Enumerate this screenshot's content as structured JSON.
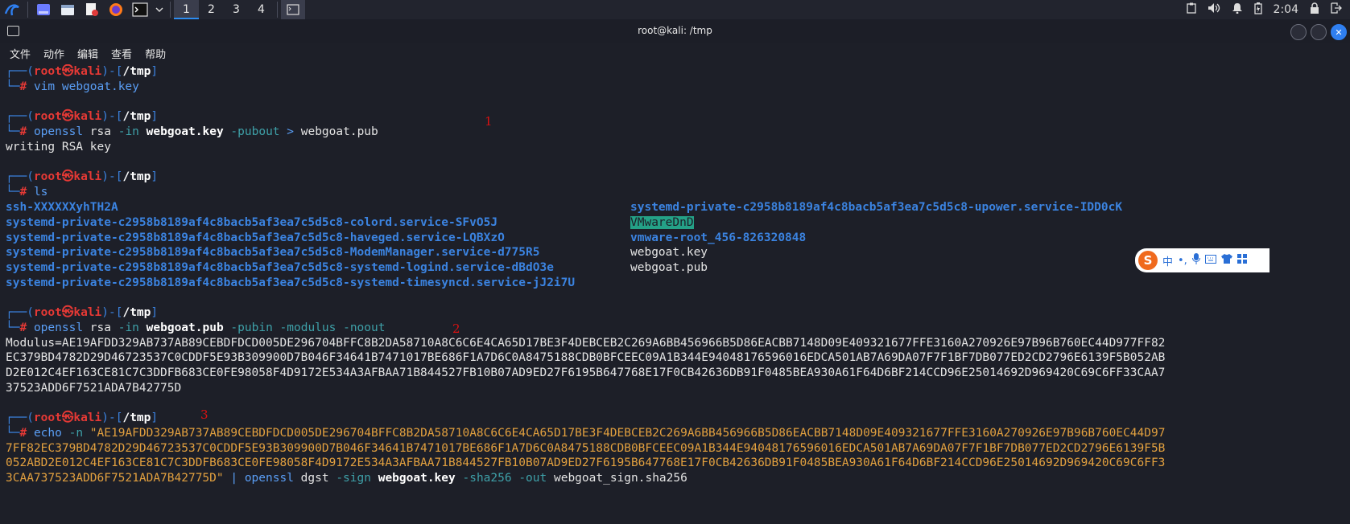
{
  "panel": {
    "workspaces": [
      "1",
      "2",
      "3",
      "4"
    ],
    "clock": "2:04"
  },
  "window": {
    "title": "root@kali: /tmp"
  },
  "menu": [
    "文件",
    "动作",
    "编辑",
    "查看",
    "帮助"
  ],
  "prompt": {
    "user": "root",
    "at": "㉿",
    "host": "kali",
    "dir": "/tmp"
  },
  "commands": {
    "c1": "vim webgoat.key",
    "c2_cmd": "openssl",
    "c2_a": "rsa",
    "c2_in": "-in",
    "c2_file": "webgoat.key",
    "c2_pubout": "-pubout",
    "c2_redir": ">",
    "c2_out": "webgoat.pub",
    "c2_output": "writing RSA key",
    "c3": "ls",
    "c4_cmd": "openssl",
    "c4_a": "rsa",
    "c4_in": "-in",
    "c4_file": "webgoat.pub",
    "c4_opts": "-pubin -modulus -noout",
    "c5_cmd": "echo",
    "c5_n": "-n",
    "c5_pipe": "|",
    "c5_tool": "openssl",
    "c5_sub": "dgst",
    "c5_sign": "-sign",
    "c5_key": "webgoat.key",
    "c5_sha": "-sha256",
    "c5_outflag": "-out",
    "c5_outfile": "webgoat_sign.sha256"
  },
  "ls_left": [
    "ssh-XXXXXXyhTH2A",
    "systemd-private-c2958b8189af4c8bacb5af3ea7c5d5c8-colord.service-SFvO5J",
    "systemd-private-c2958b8189af4c8bacb5af3ea7c5d5c8-haveged.service-LQBXzO",
    "systemd-private-c2958b8189af4c8bacb5af3ea7c5d5c8-ModemManager.service-d775R5",
    "systemd-private-c2958b8189af4c8bacb5af3ea7c5d5c8-systemd-logind.service-dBdO3e",
    "systemd-private-c2958b8189af4c8bacb5af3ea7c5d5c8-systemd-timesyncd.service-jJ2i7U"
  ],
  "ls_right": [
    "systemd-private-c2958b8189af4c8bacb5af3ea7c5d5c8-upower.service-IDD0cK",
    "VMwareDnD",
    "vmware-root_456-826320848",
    "webgoat.key",
    "webgoat.pub"
  ],
  "modulus_lines": [
    "Modulus=AE19AFDD329AB737AB89CEBDFDCD005DE296704BFFC8B2DA58710A8C6C6E4CA65D17BE3F4DEBCEB2C269A6BB456966B5D86EACBB7148D09E409321677FFE3160A270926E97B96B760EC44D977FF82",
    "EC379BD4782D29D46723537C0CDDF5E93B309900D7B046F34641B7471017BE686F1A7D6C0A8475188CDB0BFCEEC09A1B344E94048176596016EDCA501AB7A69DA07F7F1BF7DB077ED2CD2796E6139F5B052AB",
    "D2E012C4EF163CE81C7C3DDFB683CE0FE98058F4D9172E534A3AFBAA71B844527FB10B07AD9ED27F6195B647768E17F0CB42636DB91F0485BEA930A61F64D6BF214CCD96E25014692D969420C69C6FF33CAA7",
    "37523ADD6F7521ADA7B42775D"
  ],
  "echo_lines": [
    "\"AE19AFDD329AB737AB89CEBDFDCD005DE296704BFFC8B2DA58710A8C6C6E4CA65D17BE3F4DEBCEB2C269A6BB456966B5D86EACBB7148D09E409321677FFE3160A270926E97B96B760EC44D97",
    "7FF82EC379BD4782D29D46723537C0CDDF5E93B309900D7B046F34641B7471017BE686F1A7D6C0A8475188CDB0BFCEEC09A1B344E94048176596016EDCA501AB7A69DA07F7F1BF7DB077ED2CD2796E6139F5B",
    "052ABD2E012C4EF163CE81C7C3DDFB683CE0FE98058F4D9172E534A3AFBAA71B844527FB10B07AD9ED27F6195B647768E17F0CB42636DB91F0485BEA930A61F64D6BF214CCD96E25014692D969420C69C6FF3",
    "3CAA737523ADD6F7521ADA7B42775D\""
  ],
  "annotations": [
    "1",
    "2",
    "3"
  ],
  "ime": {
    "logo": "S",
    "mode": "中"
  }
}
